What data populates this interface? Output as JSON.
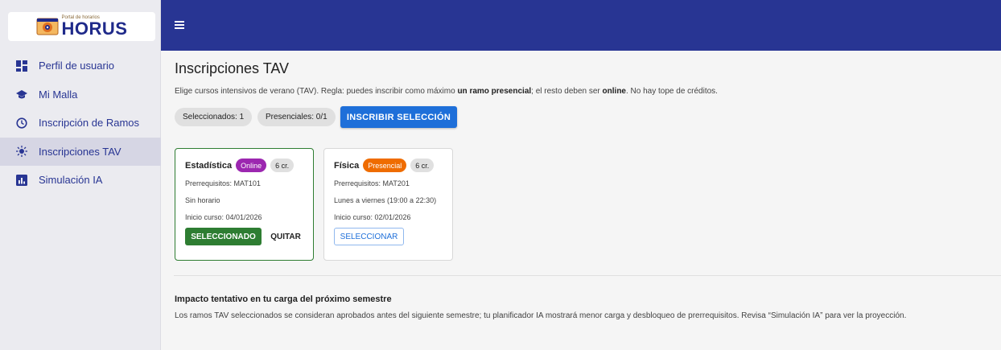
{
  "app": {
    "logo_small_text": "Portal de horarios",
    "logo_text": "HORUS"
  },
  "sidebar": {
    "items": [
      {
        "label": "Perfil de usuario",
        "icon": "dashboard-icon"
      },
      {
        "label": "Mi Malla",
        "icon": "school-icon"
      },
      {
        "label": "Inscripción de Ramos",
        "icon": "clock-icon"
      },
      {
        "label": "Inscripciones TAV",
        "icon": "sun-icon",
        "active": true
      },
      {
        "label": "Simulación IA",
        "icon": "bar-chart-icon"
      }
    ]
  },
  "topbar": {
    "menu_icon": "hamburger-icon",
    "color": "#283593"
  },
  "main": {
    "title": "Inscripciones TAV",
    "desc_part1": "Elige cursos intensivos de verano (TAV). Regla: puedes inscribir como máximo ",
    "desc_bold1": "un ramo presencial",
    "desc_part2": "; el resto deben ser ",
    "desc_bold2": "online",
    "desc_part3": ". No hay tope de créditos.",
    "chip_selected": "Seleccionados: 1",
    "chip_presential": "Presenciales: 0/1",
    "enroll_button": "INSCRIBIR SELECCIÓN"
  },
  "courses": [
    {
      "name": "Estadística",
      "modality": "Online",
      "credits": "6 cr.",
      "prereq": "Prerrequisitos: MAT101",
      "schedule": "Sin horario",
      "start": "Inicio curso: 04/01/2026",
      "selected_label": "SELECCIONADO",
      "remove_label": "QUITAR"
    },
    {
      "name": "Física",
      "modality": "Presencial",
      "credits": "6 cr.",
      "prereq": "Prerrequisitos: MAT201",
      "schedule": "Lunes a viernes (19:00 a 22:30)",
      "start": "Inicio curso: 02/01/2026",
      "select_label": "SELECCIONAR"
    }
  ],
  "impact": {
    "title": "Impacto tentativo en tu carga del próximo semestre",
    "text": "Los ramos TAV seleccionados se consideran aprobados antes del siguiente semestre; tu planificador IA mostrará menor carga y desbloqueo de prerrequisitos. Revisa “Simulación IA” para ver la proyección."
  },
  "colors": {
    "primary": "#1e6fd9",
    "selected": "#2e7d32",
    "online": "#9c27b0",
    "presencial": "#ef6c00"
  }
}
